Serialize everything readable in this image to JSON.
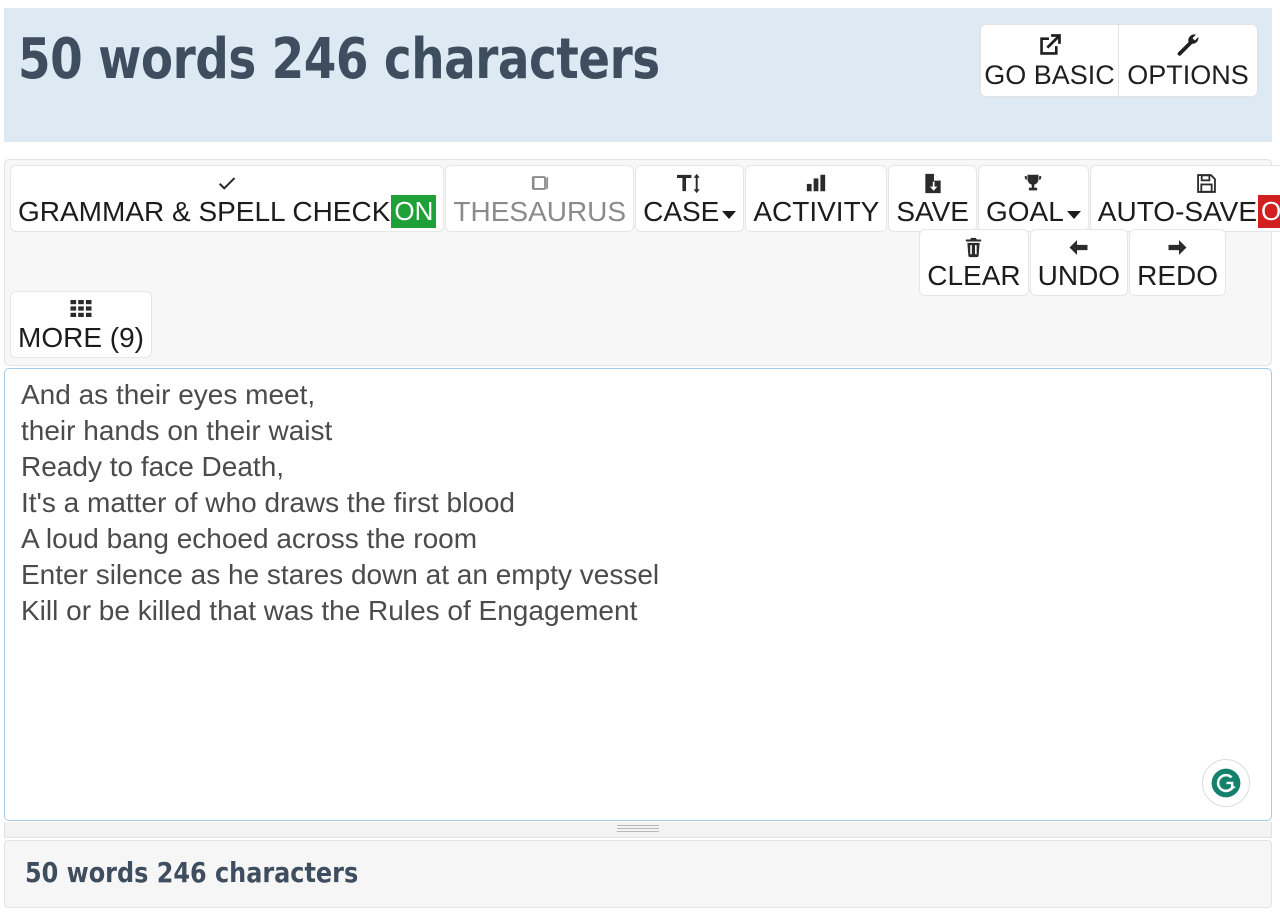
{
  "header": {
    "word_char_count": "50 words 246 characters",
    "buttons": [
      {
        "label": "GO BASIC",
        "icon": "external-link-icon"
      },
      {
        "label": "OPTIONS",
        "icon": "wrench-icon"
      }
    ]
  },
  "toolbar": {
    "row1": [
      {
        "label": "GRAMMAR & SPELL CHECK",
        "icon": "check-icon",
        "badge": "ON",
        "badge_state": "on",
        "disabled": false
      },
      {
        "label": "THESAURUS",
        "icon": "book-icon",
        "badge": "",
        "badge_state": "",
        "disabled": true
      },
      {
        "label": "CASE",
        "icon": "text-height-icon",
        "caret": true,
        "disabled": false
      },
      {
        "label": "ACTIVITY",
        "icon": "bar-chart-icon",
        "disabled": false
      },
      {
        "label": "SAVE",
        "icon": "file-download-icon",
        "disabled": false
      },
      {
        "label": "GOAL",
        "icon": "trophy-icon",
        "caret": true,
        "disabled": false
      },
      {
        "label": "AUTO-SAVE",
        "icon": "floppy-disk-icon",
        "badge": "OFF",
        "badge_state": "off",
        "disabled": false
      }
    ],
    "row2": [
      {
        "label": "CLEAR",
        "icon": "trash-icon"
      },
      {
        "label": "UNDO",
        "icon": "arrow-left-icon"
      },
      {
        "label": "REDO",
        "icon": "arrow-right-icon"
      }
    ],
    "row3": [
      {
        "label": "MORE (9)",
        "icon": "grid-icon"
      }
    ]
  },
  "editor": {
    "content": "And as their eyes meet,\ntheir hands on their waist\nReady to face Death,\nIt's a matter of who draws the first blood\nA loud bang echoed across the room\nEnter silence as he stares down at an empty vessel\nKill or be killed that was the Rules of Engagement",
    "lines": [
      "And as their eyes meet,",
      "their hands on their waist",
      "Ready to face Death,",
      "It's a matter of who draws the first blood",
      "A loud bang echoed across the room",
      "Enter silence as he stares down at an empty vessel",
      "Kill or be killed that was the Rules of Engagement"
    ],
    "assistant_icon": "grammarly-icon"
  },
  "footer": {
    "word_char_count": "50 words 246 characters"
  },
  "colors": {
    "header_bg": "#ddeaf4",
    "header_text": "#3f4e5f",
    "badge_on": "#20a038",
    "badge_off": "#d0201f",
    "editor_border": "#a6ccea",
    "grammarly_green": "#15806c"
  }
}
